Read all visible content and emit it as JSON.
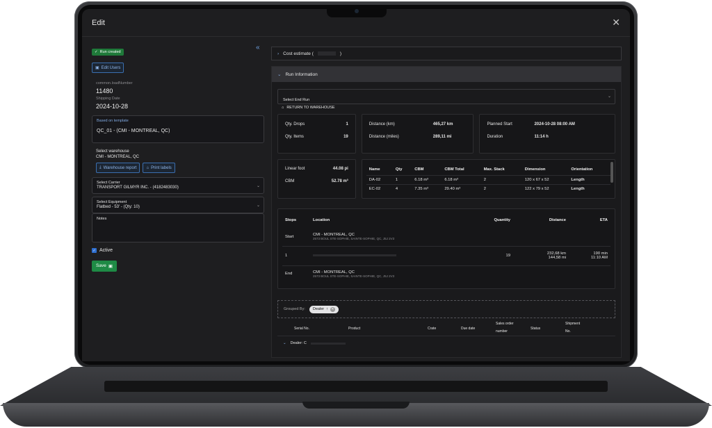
{
  "window": {
    "title": "Edit"
  },
  "left": {
    "status_badge": "Run created",
    "edit_users": "Edit Users",
    "load_label": "common.loadNumber",
    "load_value": "11480",
    "ship_label": "Shipping Date",
    "ship_value": "2024-10-28",
    "template_label": "Based on template",
    "template_value": "QC_01 - (CMI - MONTREAL, QC)",
    "warehouse_label": "Select warehouse",
    "warehouse_value": "CMI - MONTREAL, QC",
    "warehouse_report": "Warehouse report",
    "print_labels": "Print labels",
    "carrier_label": "Select Carrier",
    "carrier_value": "TRANSPORT GILMYR INC. - (4182483030)",
    "equipment_label": "Select Equipment",
    "equipment_value": "Flatbed - 53' - (Qty: 10)",
    "notes_label": "Notes",
    "active_label": "Active",
    "save": "Save"
  },
  "right": {
    "cost_estimate": "Cost estimate (",
    "cost_estimate_close": ")",
    "run_info": "Run Information",
    "end_run_label": "Select End Run",
    "end_run_value": "RETURN TO WAREHOUSE",
    "stats1": {
      "drops_l": "Qty. Drops",
      "drops_v": "1",
      "items_l": "Qty. Items",
      "items_v": "19"
    },
    "stats2": {
      "dist_l": "Distance (km)",
      "dist_v": "465,27 km",
      "miles_l": "Distance (miles)",
      "miles_v": "289,11 mi"
    },
    "stats3": {
      "start_l": "Planned Start",
      "start_v": "2024-10-28 08:00 AM",
      "dur_l": "Duration",
      "dur_v": "11:14 h"
    },
    "linear_l": "Linear foot",
    "linear_v": "44.08 pi",
    "cbm_l": "CBM",
    "cbm_v": "52.78 m³",
    "dims": {
      "headers": [
        "Name",
        "Qty",
        "CBM",
        "CBM Total",
        "Max. Stack",
        "Dimension",
        "Orientation"
      ],
      "rows": [
        [
          "DA-02",
          "1",
          "6.18 m³",
          "6.18 m³",
          "2",
          "120 x 67 x 52",
          "Length"
        ],
        [
          "EC-02",
          "4",
          "7.35 m³",
          "29.40 m³",
          "2",
          "122 x 79 x 52",
          "Length"
        ]
      ]
    },
    "stops": {
      "headers": [
        "Stops",
        "Location",
        "Quantity",
        "Distance",
        "ETA"
      ],
      "rows": [
        {
          "stop": "Start",
          "loc": "CMI - MONTREAL, QC",
          "addr": "2573 BOUL STE-SOPHIE, SAINTE-SOPHIE, QC, J5J 2V3",
          "qty": "",
          "dist": "",
          "eta": ""
        },
        {
          "stop": "1",
          "loc": "",
          "addr": "",
          "qty": "19",
          "dist": "232,68 km",
          "dist2": "144,58 mi",
          "eta": "190 min",
          "eta2": "11:10 AM"
        },
        {
          "stop": "End",
          "loc": "CMI - MONTREAL, QC",
          "addr": "2573 BOUL STE-SOPHIE, SAINTE-SOPHIE, QC, J5J 2V3",
          "qty": "",
          "dist": "",
          "eta": ""
        }
      ]
    },
    "grouped_by": "Grouped By:",
    "group_chip": "Dealer",
    "items_headers": [
      "Serial No.",
      "Product",
      "Crate",
      "Due date",
      "Sales order",
      "number",
      "Status",
      "Shipment",
      "No."
    ],
    "group_row": "Dealer: C"
  }
}
